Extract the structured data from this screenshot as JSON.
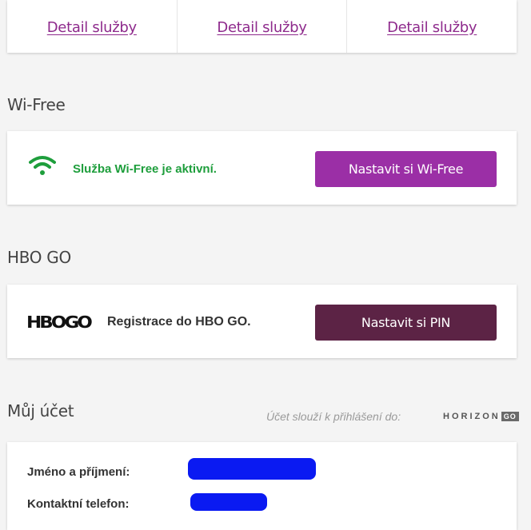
{
  "details": {
    "links": [
      "Detail služby",
      "Detail služby",
      "Detail služby"
    ]
  },
  "wifree": {
    "title": "Wi-Free",
    "status": "Služba Wi-Free je aktivní.",
    "button": "Nastavit si Wi-Free",
    "icon": "wifi-icon"
  },
  "hbo": {
    "title": "HBO GO",
    "logo": "HBOGO",
    "text": "Registrace do HBO GO.",
    "button": "Nastavit si PIN"
  },
  "account": {
    "title": "Můj účet",
    "hint": "Účet slouží k přihlášení do:",
    "horizon_word": "HORIZON",
    "horizon_go": "GO",
    "fields": [
      {
        "label": "Jméno a příjmení:"
      },
      {
        "label": "Kontaktní telefon:"
      }
    ]
  },
  "colors": {
    "link": "#8e2a8c",
    "wifree_button": "#9b2fa6",
    "hbo_button": "#5c2345",
    "active_green": "#1e9e3c"
  }
}
